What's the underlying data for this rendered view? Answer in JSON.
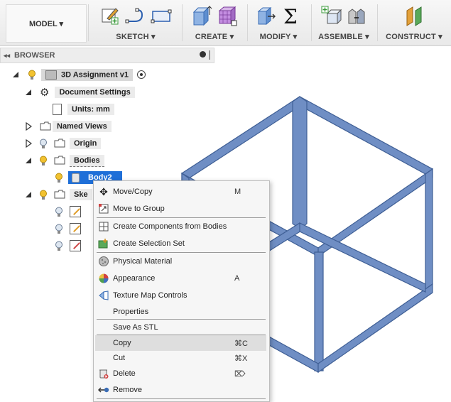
{
  "toolbar": {
    "workspace_label": "MODEL ▾",
    "groups": [
      {
        "label": "SKETCH ▾"
      },
      {
        "label": "CREATE ▾"
      },
      {
        "label": "MODIFY ▾"
      },
      {
        "label": "ASSEMBLE ▾"
      },
      {
        "label": "CONSTRUCT ▾"
      }
    ]
  },
  "browser": {
    "title": "BROWSER",
    "collapse_glyph": "◂◂",
    "items": [
      {
        "label": "3D Assignment v1"
      },
      {
        "label": "Document Settings"
      },
      {
        "label": "Units: mm"
      },
      {
        "label": "Named Views"
      },
      {
        "label": "Origin"
      },
      {
        "label": "Bodies"
      },
      {
        "label": "Body2"
      },
      {
        "label": "Ske"
      }
    ]
  },
  "context_menu": {
    "items": [
      {
        "label": "Move/Copy",
        "shortcut": "M",
        "icon": "move-icon"
      },
      {
        "label": "Move to Group",
        "shortcut": "",
        "icon": "group-icon"
      },
      {
        "label": "Create Components from Bodies",
        "shortcut": "",
        "icon": "components-icon"
      },
      {
        "label": "Create Selection Set",
        "shortcut": "",
        "icon": "selection-set-icon"
      },
      {
        "label": "Physical Material",
        "shortcut": "",
        "icon": "material-icon"
      },
      {
        "label": "Appearance",
        "shortcut": "A",
        "icon": "appearance-icon"
      },
      {
        "label": "Texture Map Controls",
        "shortcut": "",
        "icon": "texture-icon"
      },
      {
        "label": "Properties",
        "shortcut": "",
        "icon": ""
      },
      {
        "label": "Save As STL",
        "shortcut": "",
        "icon": ""
      },
      {
        "label": "Copy",
        "shortcut": "⌘C",
        "icon": ""
      },
      {
        "label": "Cut",
        "shortcut": "⌘X",
        "icon": ""
      },
      {
        "label": "Delete",
        "shortcut": "⌦",
        "icon": "delete-icon"
      },
      {
        "label": "Remove",
        "shortcut": "",
        "icon": "remove-icon"
      }
    ]
  },
  "colors": {
    "cube_fill": "#6f8ec4",
    "cube_edge": "#3f5f95",
    "selection": "#1f6fd8"
  }
}
